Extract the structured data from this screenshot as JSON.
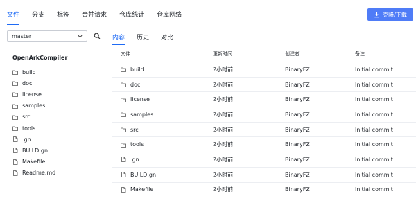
{
  "tabs": [
    "文件",
    "分支",
    "标签",
    "合并请求",
    "仓库统计",
    "仓库网络"
  ],
  "clone_button": "克隆/下载",
  "sidebar": {
    "branch": "master",
    "repo_name": "OpenArkCompiler",
    "items": [
      {
        "name": "build",
        "type": "folder"
      },
      {
        "name": "doc",
        "type": "folder"
      },
      {
        "name": "license",
        "type": "folder"
      },
      {
        "name": "samples",
        "type": "folder"
      },
      {
        "name": "src",
        "type": "folder"
      },
      {
        "name": "tools",
        "type": "folder"
      },
      {
        "name": ".gn",
        "type": "file"
      },
      {
        "name": "BUILD.gn",
        "type": "file"
      },
      {
        "name": "Makefile",
        "type": "file"
      },
      {
        "name": "Readme.md",
        "type": "file"
      }
    ]
  },
  "subtabs": [
    "内容",
    "历史",
    "对比"
  ],
  "table": {
    "headers": [
      "文件",
      "更新时间",
      "创建者",
      "备注"
    ],
    "rows": [
      {
        "name": "build",
        "type": "folder",
        "time": "2小时前",
        "author": "BinaryFZ",
        "note": "Initial commit"
      },
      {
        "name": "doc",
        "type": "folder",
        "time": "2小时前",
        "author": "BinaryFZ",
        "note": "Initial commit"
      },
      {
        "name": "license",
        "type": "folder",
        "time": "2小时前",
        "author": "BinaryFZ",
        "note": "Initial commit"
      },
      {
        "name": "samples",
        "type": "folder",
        "time": "2小时前",
        "author": "BinaryFZ",
        "note": "Initial commit"
      },
      {
        "name": "src",
        "type": "folder",
        "time": "2小时前",
        "author": "BinaryFZ",
        "note": "Initial commit"
      },
      {
        "name": "tools",
        "type": "folder",
        "time": "2小时前",
        "author": "BinaryFZ",
        "note": "Initial commit"
      },
      {
        "name": ".gn",
        "type": "file",
        "time": "2小时前",
        "author": "BinaryFZ",
        "note": "Initial commit"
      },
      {
        "name": "BUILD.gn",
        "type": "file",
        "time": "2小时前",
        "author": "BinaryFZ",
        "note": "Initial commit"
      },
      {
        "name": "Makefile",
        "type": "file",
        "time": "2小时前",
        "author": "BinaryFZ",
        "note": "Initial commit"
      }
    ]
  },
  "colors": {
    "accent": "#1f6bf5",
    "button": "#4f7cf7"
  }
}
